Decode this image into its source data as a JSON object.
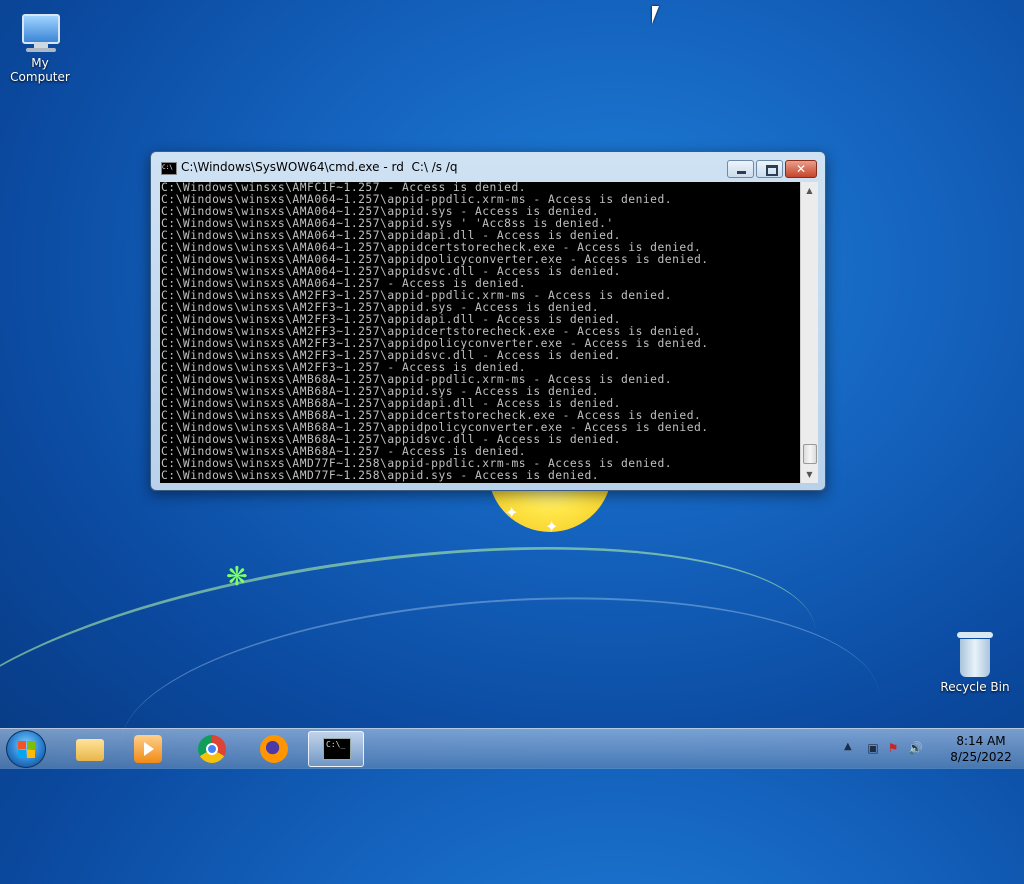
{
  "desktop": {
    "icons": [
      {
        "label": "My Computer"
      },
      {
        "label": "Recycle Bin"
      }
    ]
  },
  "window": {
    "title": "C:\\Windows\\SysWOW64\\cmd.exe - rd  C:\\ /s /q",
    "buttons": {
      "minimize": "minimize",
      "maximize": "maximize",
      "close": "✕"
    },
    "console_lines": [
      "C:\\Windows\\winsxs\\AMFC1F~1.257 - Access is denied.",
      "C:\\Windows\\winsxs\\AMA064~1.257\\appid-ppdlic.xrm-ms - Access is denied.",
      "C:\\Windows\\winsxs\\AMA064~1.257\\appid.sys - Access is denied.",
      "C:\\Windows\\winsxs\\AMA064~1.257\\appid.sys ' 'Acc8ss is denied.'",
      "C:\\Windows\\winsxs\\AMA064~1.257\\appidapi.dll - Access is denied.",
      "C:\\Windows\\winsxs\\AMA064~1.257\\appidcertstorecheck.exe - Access is denied.",
      "C:\\Windows\\winsxs\\AMA064~1.257\\appidpolicyconverter.exe - Access is denied.",
      "C:\\Windows\\winsxs\\AMA064~1.257\\appidsvc.dll - Access is denied.",
      "C:\\Windows\\winsxs\\AMA064~1.257 - Access is denied.",
      "C:\\Windows\\winsxs\\AM2FF3~1.257\\appid-ppdlic.xrm-ms - Access is denied.",
      "C:\\Windows\\winsxs\\AM2FF3~1.257\\appid.sys - Access is denied.",
      "C:\\Windows\\winsxs\\AM2FF3~1.257\\appidapi.dll - Access is denied.",
      "C:\\Windows\\winsxs\\AM2FF3~1.257\\appidcertstorecheck.exe - Access is denied.",
      "C:\\Windows\\winsxs\\AM2FF3~1.257\\appidpolicyconverter.exe - Access is denied.",
      "C:\\Windows\\winsxs\\AM2FF3~1.257\\appidsvc.dll - Access is denied.",
      "C:\\Windows\\winsxs\\AM2FF3~1.257 - Access is denied.",
      "C:\\Windows\\winsxs\\AMB68A~1.257\\appid-ppdlic.xrm-ms - Access is denied.",
      "C:\\Windows\\winsxs\\AMB68A~1.257\\appid.sys - Access is denied.",
      "C:\\Windows\\winsxs\\AMB68A~1.257\\appidapi.dll - Access is denied.",
      "C:\\Windows\\winsxs\\AMB68A~1.257\\appidcertstorecheck.exe - Access is denied.",
      "C:\\Windows\\winsxs\\AMB68A~1.257\\appidpolicyconverter.exe - Access is denied.",
      "C:\\Windows\\winsxs\\AMB68A~1.257\\appidsvc.dll - Access is denied.",
      "C:\\Windows\\winsxs\\AMB68A~1.257 - Access is denied.",
      "C:\\Windows\\winsxs\\AMD77F~1.258\\appid-ppdlic.xrm-ms - Access is denied.",
      "C:\\Windows\\winsxs\\AMD77F~1.258\\appid.sys - Access is denied."
    ]
  },
  "taskbar": {
    "items": [
      {
        "name": "start-button",
        "icon": "windows-logo-icon"
      },
      {
        "name": "explorer",
        "icon": "folder-icon"
      },
      {
        "name": "media-player",
        "icon": "media-player-icon"
      },
      {
        "name": "chrome",
        "icon": "chrome-icon"
      },
      {
        "name": "firefox",
        "icon": "firefox-icon"
      },
      {
        "name": "cmd",
        "icon": "cmd-icon",
        "active": true
      }
    ],
    "tray": {
      "icons": [
        "show-hidden-icons-arrow",
        "network-icon",
        "action-center-icon",
        "volume-icon"
      ],
      "time": "8:14 AM",
      "date": "8/25/2022"
    }
  },
  "colors": {
    "desktop_bg": "#1565c0",
    "console_bg": "#000000",
    "console_fg": "#c0c0c0",
    "close_button": "#c7432a"
  }
}
